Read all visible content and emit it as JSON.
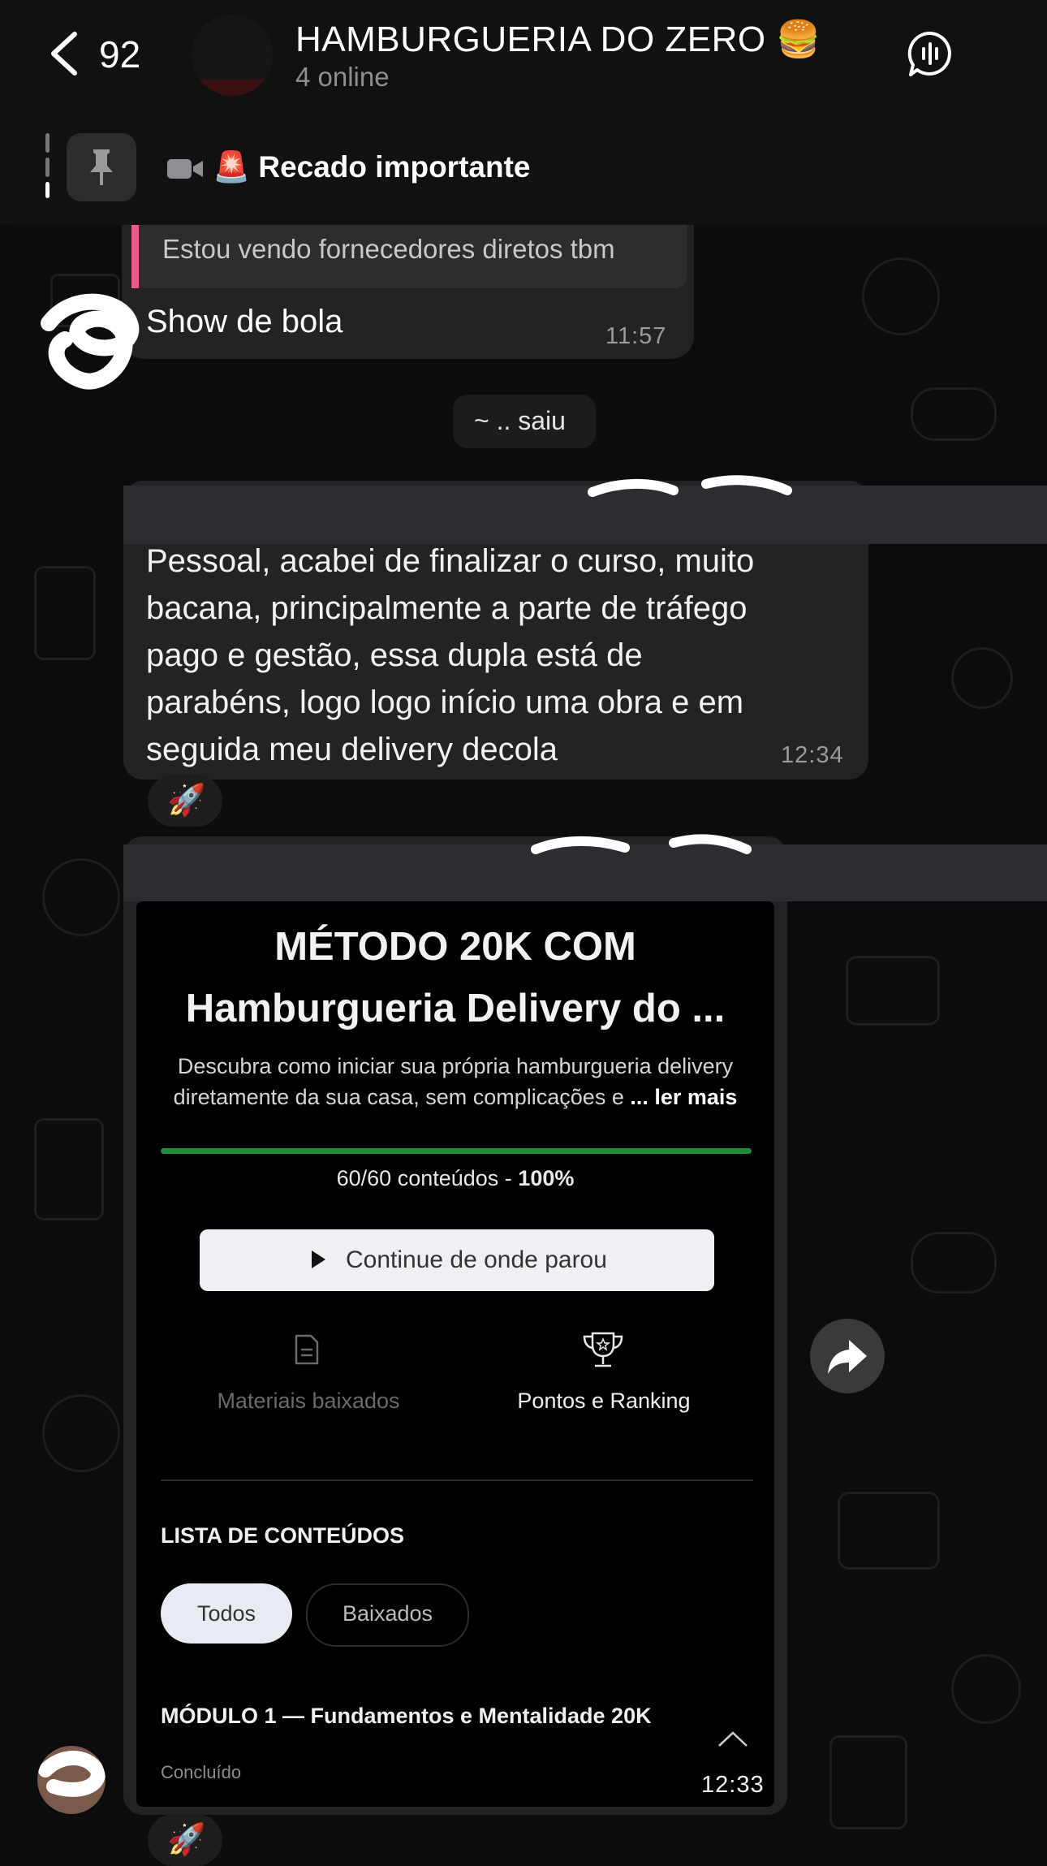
{
  "header": {
    "back_count": "92",
    "title": "HAMBURGUERIA DO ZERO 🍔",
    "subtitle": "4 online"
  },
  "pinned": {
    "text": "🚨 Recado importante"
  },
  "messages": {
    "quoted_text": "Estou vendo fornecedores diretos tbm",
    "msg1_text": "Show de bola",
    "msg1_time": "11:57",
    "system_text": "~ .. saiu",
    "msg2_lines": [
      "Pessoal,  acabei de finalizar o curso,  muito",
      "bacana, principalmente a parte de tráfego",
      "pago e gestão,  essa dupla está de",
      "parabéns,  logo logo início uma obra e em",
      "seguida meu delivery decola"
    ],
    "msg2_time": "12:34",
    "msg2_reaction": "🚀",
    "msg3_time": "12:33",
    "msg3_reaction": "🚀"
  },
  "course_screenshot": {
    "title_line1": "MÉTODO 20K COM",
    "title_line2": "Hamburgueria Delivery do ...",
    "desc_line1": "Descubra como iniciar sua própria hamburgueria delivery",
    "desc_line2": "diretamente da sua casa, sem complicações e",
    "read_more": "... ler mais",
    "progress_fraction": 1.0,
    "progress_label": "60/60 conteúdos - ",
    "progress_percent": "100%",
    "cta_label": "Continue de onde parou",
    "materials_label": "Materiais baixados",
    "ranking_label": "Pontos e Ranking",
    "list_heading": "LISTA DE CONTEÚDOS",
    "chip_all": "Todos",
    "chip_downloaded": "Baixados",
    "module_title": "MÓDULO 1 — Fundamentos e Mentalidade 20K",
    "module_status": "Concluído"
  },
  "colors": {
    "quote_accent": "#e95b8a",
    "progress": "#1f8a3b",
    "bubble": "#232323"
  }
}
